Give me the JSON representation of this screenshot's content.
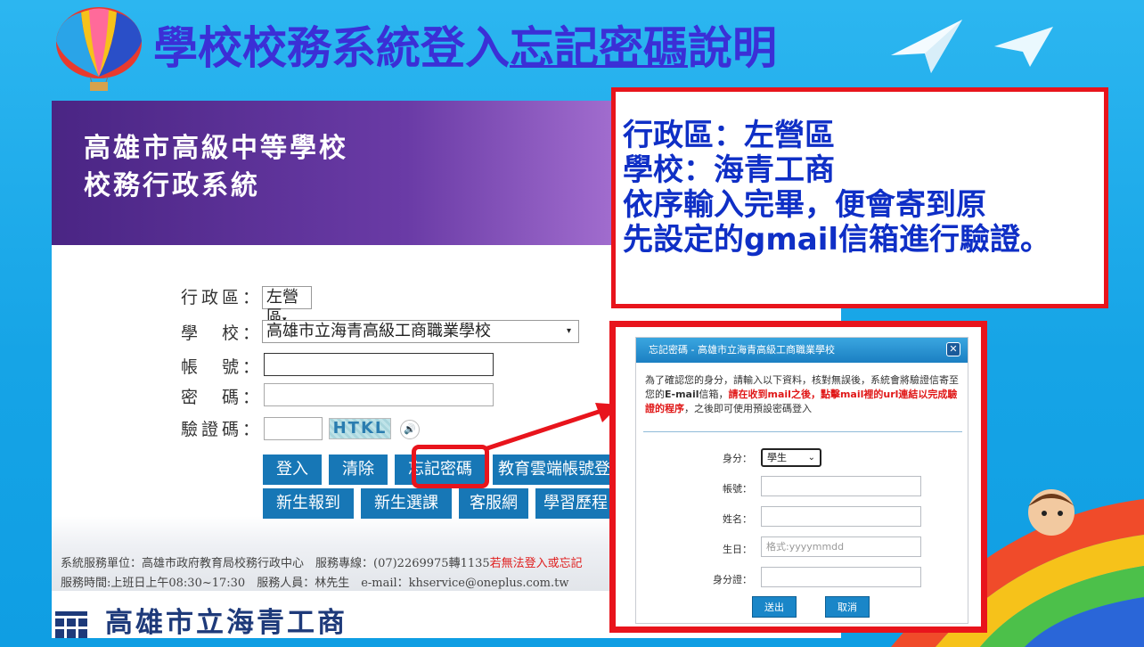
{
  "slide": {
    "title_main": "學校校務系統登入",
    "title_underlined": "忘記密碼",
    "title_end": "說明"
  },
  "banner": {
    "line1": "高雄市高級中等學校",
    "line2": "校務行政系統"
  },
  "form": {
    "district_label": "行政區：",
    "district_value": "左營區",
    "school_label": "學　校：",
    "school_value": "高雄市立海青高級工商職業學校",
    "account_label": "帳　號：",
    "password_label": "密　碼：",
    "captcha_label": "驗證碼：",
    "captcha_text": "HTKL"
  },
  "buttons": {
    "login": "登入",
    "clear": "清除",
    "forgot": "忘記密碼",
    "cloud": "教育雲端帳號登",
    "new_report": "新生報到",
    "new_course": "新生選課",
    "service": "客服網",
    "portfolio": "學習歷程"
  },
  "footer": {
    "line1": "系統服務單位：高雄市政府教育局校務行政中心　服務專線：(07)2269975轉1135",
    "line1_red": "若無法登入或忘記",
    "line2": "服務時間:上班日上午08:30~17:30　服務人員：林先生　e-mail：khservice@oneplus.com.tw",
    "school": "高雄市立海青工商"
  },
  "info": {
    "line1": "行政區：左營區",
    "line2": "學校：海青工商",
    "line3": "依序輸入完畢，便會寄到原",
    "line4": "先設定的gmail信箱進行驗證。"
  },
  "modal": {
    "title": "忘記密碼 - 高雄市立海青高級工商職業學校",
    "msg1": "為了確認您的身分，請輸入以下資料，核對無誤後，系統會將驗證信寄至您的",
    "msg_bold": "E-mail",
    "msg2": "信箱，",
    "msg_red": "請在收到mail之後，點擊mail裡的url連結以完成驗證的程序",
    "msg3": "，之後即可使用預設密碼登入",
    "identity_label": "身分：",
    "identity_value": "學生",
    "account_label": "帳號：",
    "name_label": "姓名：",
    "birthday_label": "生日：",
    "birthday_placeholder": "格式:yyyymmdd",
    "id_label": "身分證：",
    "submit": "送出",
    "cancel": "取消"
  },
  "colors": {
    "background": "#16a4e6",
    "title": "#3b2fd6",
    "callout_border": "#e8141c",
    "info_text": "#0f2fc6",
    "button": "#1777b6"
  }
}
